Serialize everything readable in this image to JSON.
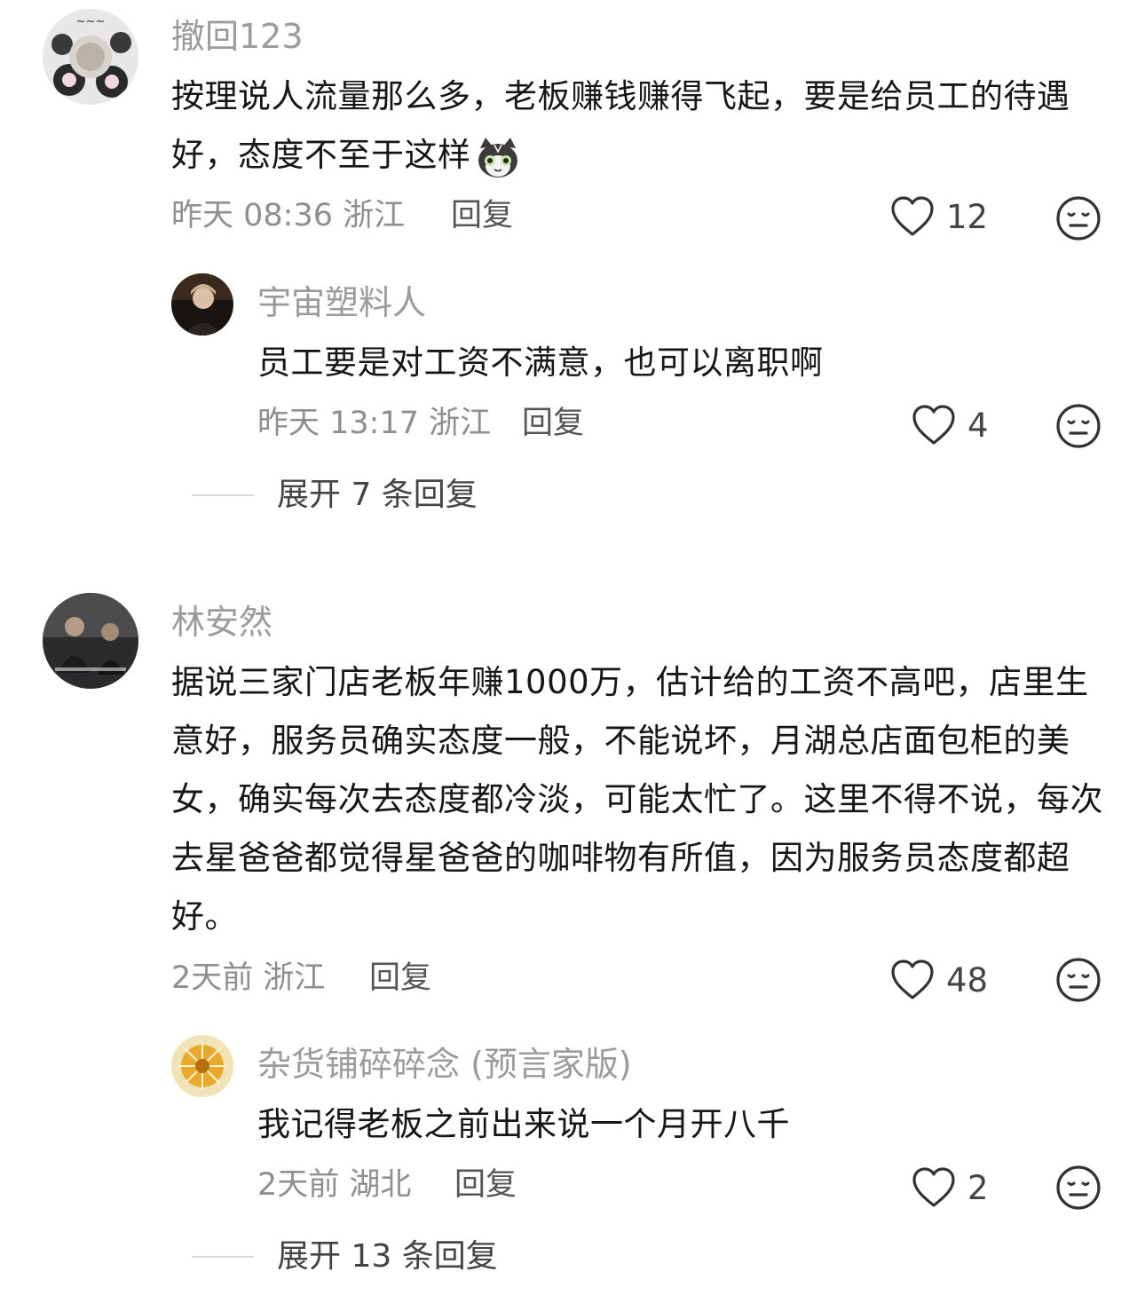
{
  "comments": [
    {
      "username": "撤回123",
      "text": "按理说人流量那么多，老板赚钱赚得飞起，要是给员工的待遇好，态度不至于这样",
      "emoji": "cat-emoji",
      "time": "昨天 08:36",
      "location": "浙江",
      "reply_label": "回复",
      "likes": "12",
      "sub": {
        "username": "宇宙塑料人",
        "text": "员工要是对工资不满意，也可以离职啊",
        "time": "昨天 13:17",
        "location": "浙江",
        "reply_label": "回复",
        "likes": "4"
      },
      "expand_label": "展开 7 条回复"
    },
    {
      "username": "林安然",
      "text": "据说三家门店老板年赚1000万，估计给的工资不高吧，店里生意好，服务员确实态度一般，不能说坏，月湖总店面包柜的美女，确实每次去态度都冷淡，可能太忙了。这里不得不说，每次去星爸爸都觉得星爸爸的咖啡物有所值，因为服务员态度都超好。",
      "time": "2天前",
      "location": "浙江",
      "reply_label": "回复",
      "likes": "48",
      "sub": {
        "username": "杂货铺碎碎念 (预言家版)",
        "text": "我记得老板之前出来说一个月开八千",
        "time": "2天前",
        "location": "湖北",
        "reply_label": "回复",
        "likes": "2"
      },
      "expand_label": "展开 13 条回复"
    }
  ],
  "icons": {
    "like": "heart-outline-icon",
    "dislike": "meh-face-icon"
  },
  "colors": {
    "name": "#9b9b9b",
    "meta": "#8f8f8f",
    "text": "#161616"
  }
}
